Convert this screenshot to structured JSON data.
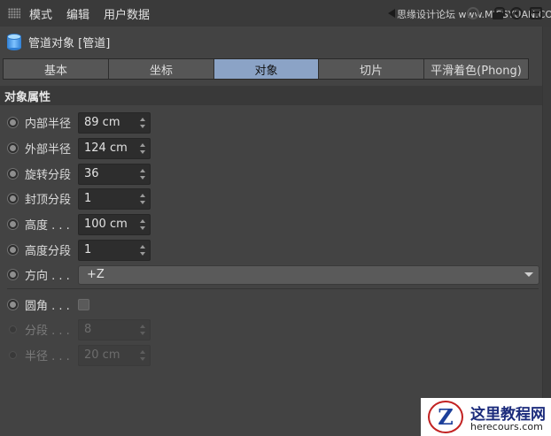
{
  "menubar": {
    "items": [
      "模式",
      "编辑",
      "用户数据"
    ],
    "watermark": "思缘设计论坛 www.MISSYUAN.COM"
  },
  "object": {
    "title": "管道对象 [管道]"
  },
  "tabs": [
    {
      "label": "基本",
      "active": false
    },
    {
      "label": "坐标",
      "active": false
    },
    {
      "label": "对象",
      "active": true
    },
    {
      "label": "切片",
      "active": false
    },
    {
      "label": "平滑着色(Phong)",
      "active": false
    }
  ],
  "section": {
    "title": "对象属性"
  },
  "params": {
    "inner_radius": {
      "label": "内部半径",
      "value": "89 cm"
    },
    "outer_radius": {
      "label": "外部半径",
      "value": "124 cm"
    },
    "rotation_segments": {
      "label": "旋转分段",
      "value": "36"
    },
    "cap_segments": {
      "label": "封顶分段",
      "value": "1"
    },
    "height": {
      "label": "高度 . . .",
      "value": "100 cm"
    },
    "height_segments": {
      "label": "高度分段",
      "value": "1"
    },
    "orientation": {
      "label": "方向 . . .",
      "value": "+Z"
    },
    "fillet": {
      "label": "圆角 . . .",
      "checked": false
    },
    "fillet_segments": {
      "label": "分段 . . .",
      "value": "8"
    },
    "fillet_radius": {
      "label": "半径 . . .",
      "value": "20 cm"
    }
  },
  "logo": {
    "mark": "Z",
    "name": "这里教程网",
    "url": "herecours.com"
  }
}
